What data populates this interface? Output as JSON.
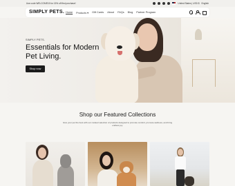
{
  "announcement": {
    "message": "Use code WELCOME15 for 15% off first purchase!",
    "currency": "United States | USD $",
    "language": "English"
  },
  "header": {
    "logo": "SIMPLY PETS.",
    "menu": [
      {
        "label": "Home",
        "active": true
      },
      {
        "label": "Products ▾"
      },
      {
        "label": "Gift Cards"
      },
      {
        "label": "About"
      },
      {
        "label": "FAQs"
      },
      {
        "label": "Blog"
      },
      {
        "label": "Partner Program"
      }
    ]
  },
  "hero": {
    "brand": "SIMPLY PETS.",
    "headline": "Essentials for Modern Pet Living.",
    "cta": "Shop now"
  },
  "featured": {
    "title": "Shop our Featured Collections",
    "subtitle": "Give your pet the best with our curated selection of products designed to promote comfort, promote wellness, and bring endless joy."
  },
  "colors": {
    "dark": "#1b1b1b",
    "background": "#f6f5f2"
  }
}
